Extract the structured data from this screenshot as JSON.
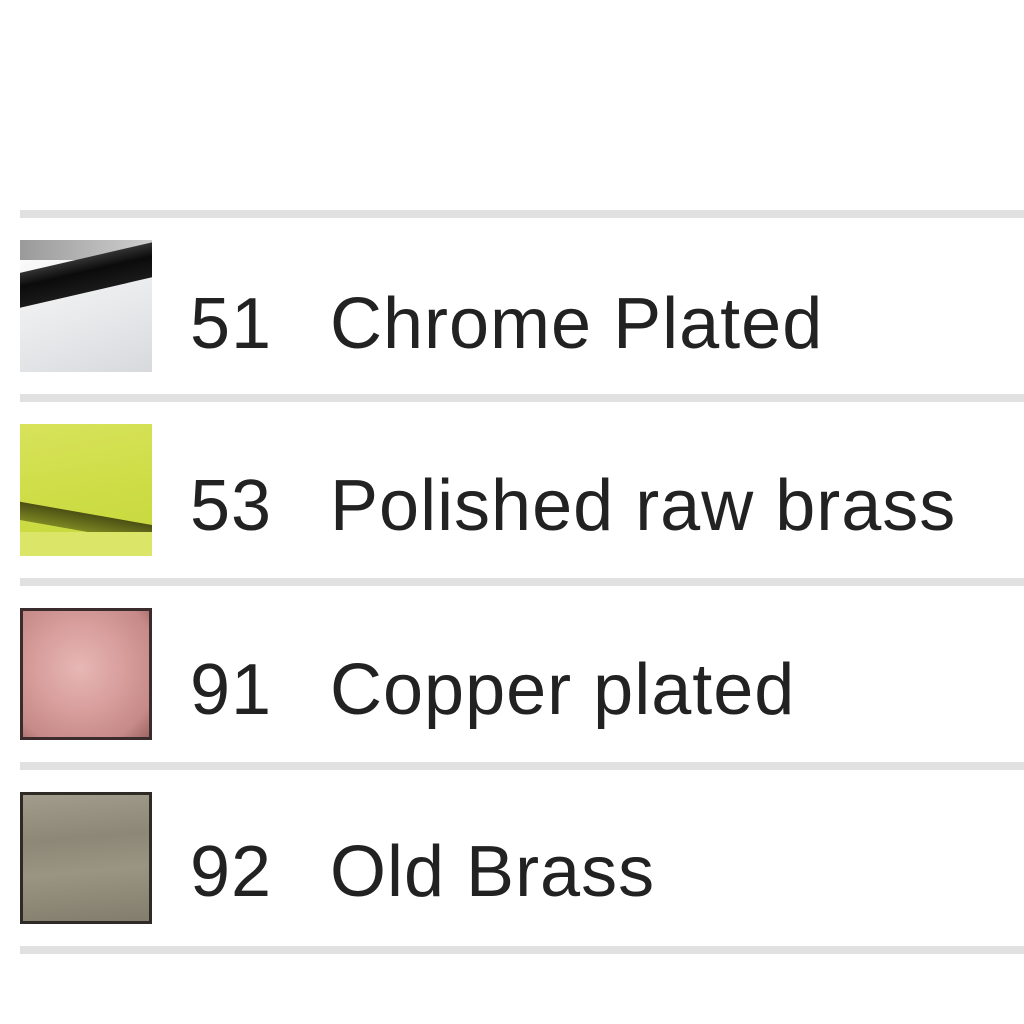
{
  "finishes": [
    {
      "code": "51",
      "name": "Chrome Plated",
      "swatch": "chrome-swatch",
      "color": "#e6e8ea"
    },
    {
      "code": "53",
      "name": "Polished raw brass",
      "swatch": "brass-swatch",
      "color": "#cddc45"
    },
    {
      "code": "91",
      "name": "Copper plated",
      "swatch": "copper-swatch",
      "color": "#d79e9c"
    },
    {
      "code": "92",
      "name": "Old Brass",
      "swatch": "old-brass-swatch",
      "color": "#8d8777"
    }
  ]
}
